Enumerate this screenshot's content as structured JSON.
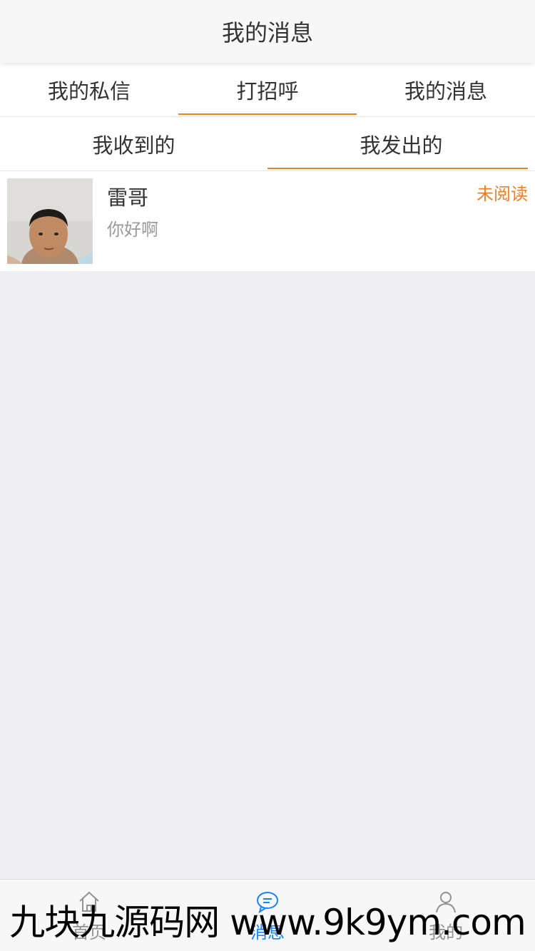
{
  "header": {
    "title": "我的消息"
  },
  "primary_tabs": [
    {
      "label": "我的私信",
      "active": false
    },
    {
      "label": "打招呼",
      "active": true
    },
    {
      "label": "我的消息",
      "active": false
    }
  ],
  "secondary_tabs": [
    {
      "label": "我收到的",
      "active": false
    },
    {
      "label": "我发出的",
      "active": true
    }
  ],
  "messages": [
    {
      "name": "雷哥",
      "preview": "你好啊",
      "status": "未阅读"
    }
  ],
  "bottom_nav": [
    {
      "label": "首页",
      "icon": "home-icon",
      "active": false
    },
    {
      "label": "消息",
      "icon": "chat-bubble-icon",
      "active": true
    },
    {
      "label": "我的",
      "icon": "user-icon",
      "active": false
    }
  ],
  "colors": {
    "accent": "#f47d22",
    "active_nav": "#1a82ff",
    "background": "#efeff4"
  },
  "watermark": "九块九源码网 www.9k9ym.com"
}
